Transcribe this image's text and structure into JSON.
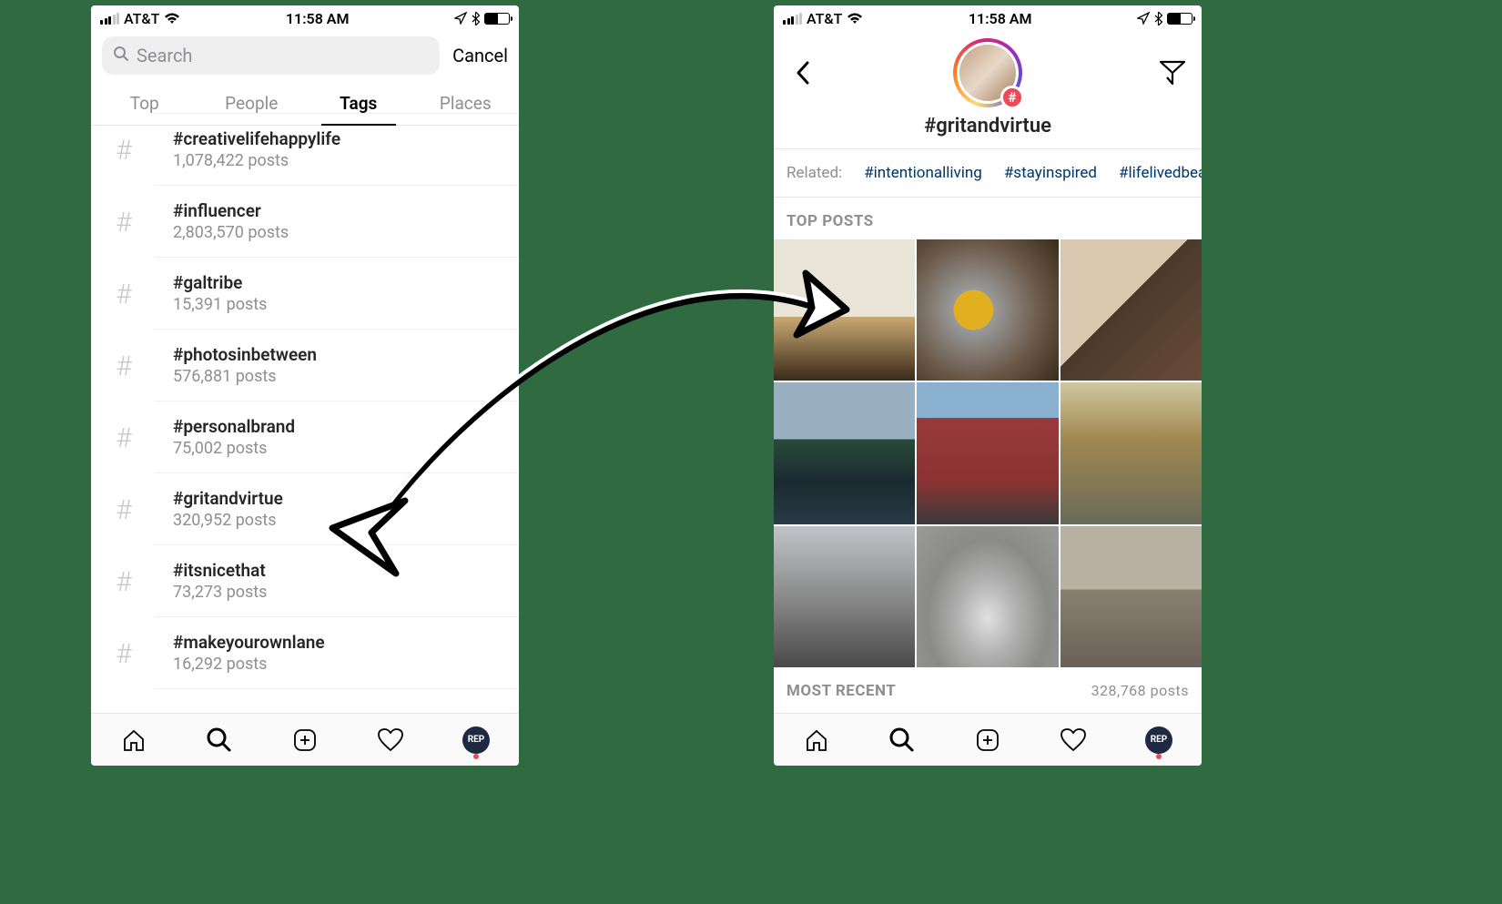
{
  "statusbar": {
    "carrier": "AT&T",
    "time": "11:58 AM"
  },
  "left": {
    "search": {
      "placeholder": "Search",
      "cancel": "Cancel"
    },
    "tabs": [
      "Top",
      "People",
      "Tags",
      "Places"
    ],
    "active_tab": "Tags",
    "results": [
      {
        "name": "#creativelifehappylife",
        "count": "1,078,422 posts"
      },
      {
        "name": "#influencer",
        "count": "2,803,570 posts"
      },
      {
        "name": "#galtribe",
        "count": "15,391 posts"
      },
      {
        "name": "#photosinbetween",
        "count": "576,881 posts"
      },
      {
        "name": "#personalbrand",
        "count": "75,002 posts"
      },
      {
        "name": "#gritandvirtue",
        "count": "320,952 posts"
      },
      {
        "name": "#itsnicethat",
        "count": "73,273 posts"
      },
      {
        "name": "#makeyourownlane",
        "count": "16,292 posts"
      }
    ]
  },
  "right": {
    "hashtag": "#gritandvirtue",
    "related_label": "Related:",
    "related": [
      "#intentionalliving",
      "#stayinspired",
      "#lifelivedbeautifu"
    ],
    "top_posts_label": "TOP POSTS",
    "most_recent_label": "MOST RECENT",
    "most_recent_count": "328,768 posts"
  },
  "nav": {
    "profile_label": "REP"
  }
}
